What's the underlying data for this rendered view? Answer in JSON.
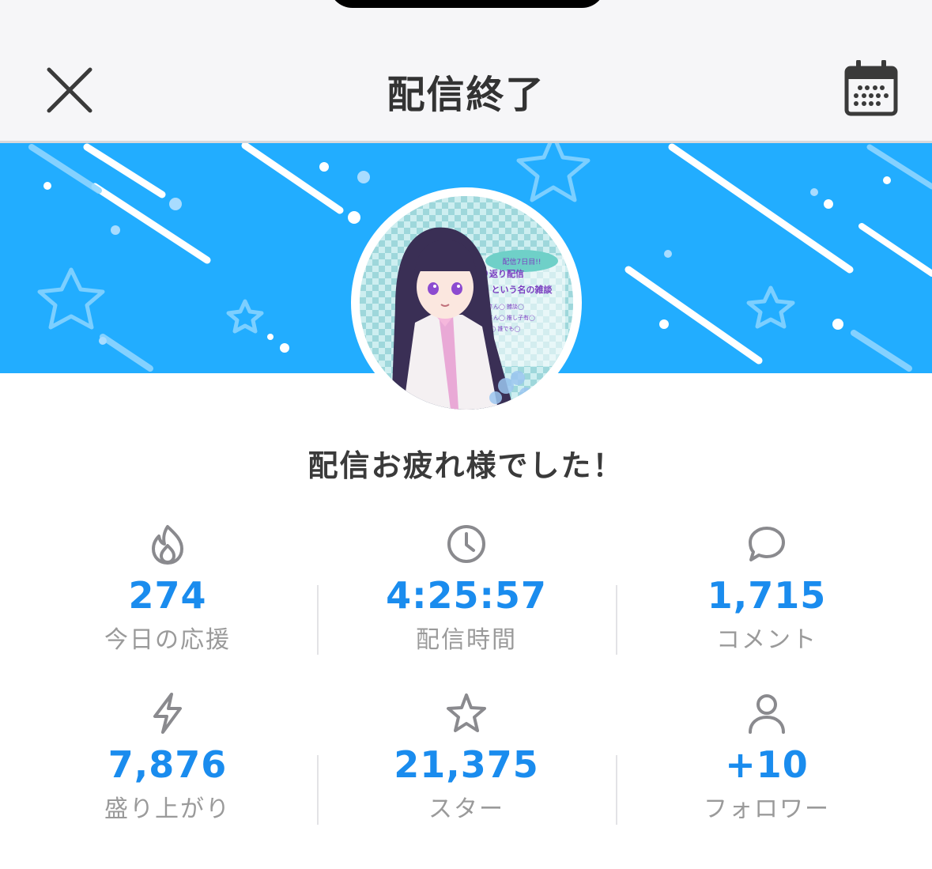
{
  "header": {
    "title": "配信終了",
    "close_icon": "close-icon",
    "calendar_icon": "calendar-icon"
  },
  "banner": {
    "background_color": "#22adff",
    "avatar": {
      "thumb_lines": [
        "配信7日目!!",
        "振り返り配信",
        "という名の雑談",
        "初見さん◯ 雑談◯",
        "常連さん◯ 推し子有◯",
        "ROM◯ 誰でも◯"
      ]
    }
  },
  "message": "配信お疲れ様でした！",
  "stats": [
    {
      "icon": "fire-icon",
      "value": "274",
      "label": "今日の応援"
    },
    {
      "icon": "clock-icon",
      "value": "4:25:57",
      "label": "配信時間"
    },
    {
      "icon": "comment-icon",
      "value": "1,715",
      "label": "コメント"
    },
    {
      "icon": "lightning-icon",
      "value": "7,876",
      "label": "盛り上がり"
    },
    {
      "icon": "star-icon",
      "value": "21,375",
      "label": "スター"
    },
    {
      "icon": "person-icon",
      "value": "+10",
      "label": "フォロワー"
    }
  ],
  "colors": {
    "accent": "#1a8cee",
    "label": "#9a9a9a",
    "icon": "#8a8a8e"
  }
}
